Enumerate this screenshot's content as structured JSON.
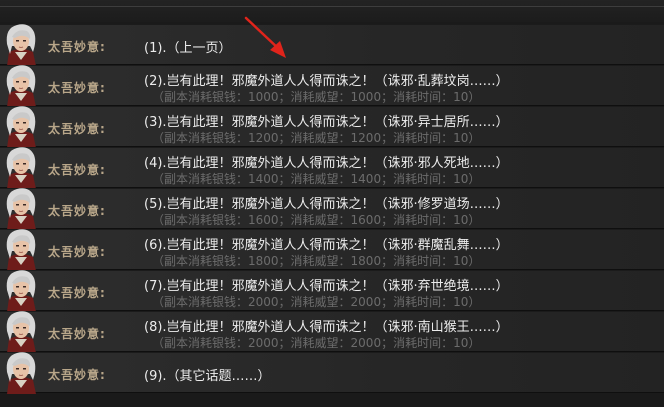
{
  "speaker_name": "太吾妙意:",
  "options": [
    {
      "text": "(1).（上一页）",
      "cost": ""
    },
    {
      "text": "(2).岂有此理！邪魔外道人人得而诛之！（诛邪·乱葬坟岗……）",
      "cost": "（副本消耗银钱：1000；消耗威望：1000；消耗时间：10）"
    },
    {
      "text": "(3).岂有此理！邪魔外道人人得而诛之！（诛邪·异士居所……）",
      "cost": "（副本消耗银钱：1200；消耗威望：1200；消耗时间：10）"
    },
    {
      "text": "(4).岂有此理！邪魔外道人人得而诛之！（诛邪·邪人死地……）",
      "cost": "（副本消耗银钱：1400；消耗威望：1400；消耗时间：10）"
    },
    {
      "text": "(5).岂有此理！邪魔外道人人得而诛之！（诛邪·修罗道场……）",
      "cost": "（副本消耗银钱：1600；消耗威望：1600；消耗时间：10）"
    },
    {
      "text": "(6).岂有此理！邪魔外道人人得而诛之！（诛邪·群魔乱舞……）",
      "cost": "（副本消耗银钱：1800；消耗威望：1800；消耗时间：10）"
    },
    {
      "text": "(7).岂有此理！邪魔外道人人得而诛之！（诛邪·弃世绝境……）",
      "cost": "（副本消耗银钱：2000；消耗威望：2000；消耗时间：10）"
    },
    {
      "text": "(8).岂有此理！邪魔外道人人得而诛之！（诛邪·南山猴王……）",
      "cost": "（副本消耗银钱：2000；消耗威望：2000；消耗时间：10）"
    },
    {
      "text": "(9).（其它话题……）",
      "cost": ""
    }
  ],
  "colors": {
    "option_text": "#ececec",
    "cost_text": "#6c6c6c",
    "speaker_text": "#b9a78a",
    "arrow": "#e0241b"
  }
}
